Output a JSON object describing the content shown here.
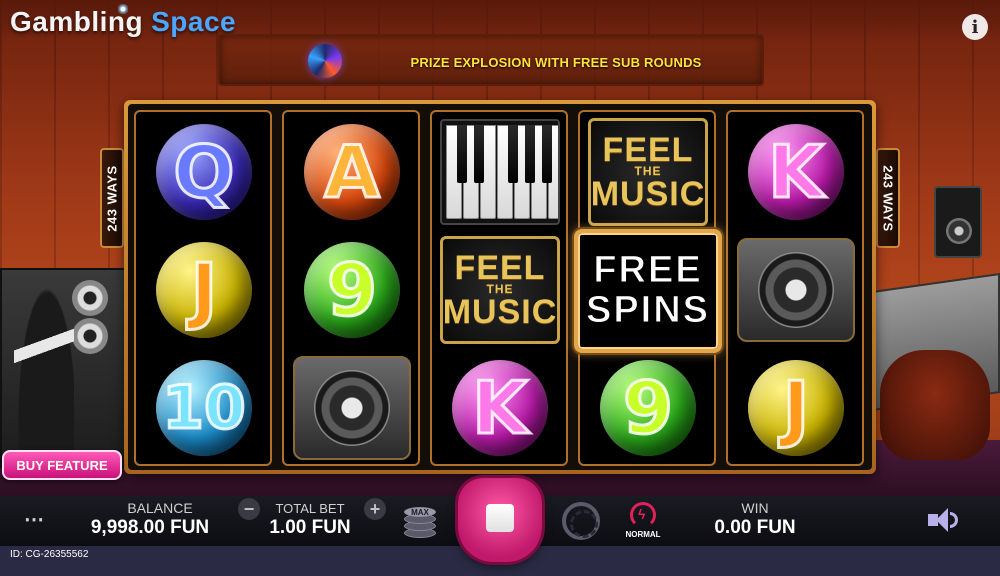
{
  "app": {
    "logo_word1": "Gambling",
    "logo_word2": "Space",
    "info_label": "i"
  },
  "banner": {
    "text": "PRIZE EXPLOSION WITH FREE SUB ROUNDS"
  },
  "ways": {
    "left": "243 WAYS",
    "right": "243 WAYS"
  },
  "reels": [
    [
      {
        "symbol": "Q",
        "style": "orb-blue"
      },
      {
        "symbol": "J",
        "style": "orb-yellow"
      },
      {
        "symbol": "10",
        "style": "orb-cyan"
      }
    ],
    [
      {
        "symbol": "A",
        "style": "orb-orange"
      },
      {
        "symbol": "9",
        "style": "orb-green"
      },
      {
        "symbol": "speaker",
        "style": "speaker"
      }
    ],
    [
      {
        "symbol": "piano",
        "style": "piano"
      },
      {
        "symbol": "feel-the-music",
        "style": "feel"
      },
      {
        "symbol": "K",
        "style": "orb-magenta"
      }
    ],
    [
      {
        "symbol": "feel-the-music",
        "style": "feel"
      },
      {
        "symbol": "free-spins",
        "style": "freespins"
      },
      {
        "symbol": "9",
        "style": "orb-green"
      }
    ],
    [
      {
        "symbol": "K",
        "style": "orb-magenta"
      },
      {
        "symbol": "speaker",
        "style": "speaker"
      },
      {
        "symbol": "J",
        "style": "orb-yellow"
      }
    ]
  ],
  "symbols_text": {
    "Q": "Q",
    "J": "J",
    "10": "10",
    "A": "A",
    "9": "9",
    "K": "K",
    "feel_line1": "FEEL",
    "feel_line2": "THE",
    "feel_line3": "MUSIC",
    "free_line1": "FREE",
    "free_line2": "SPINS"
  },
  "buy_feature": {
    "label": "BUY FEATURE"
  },
  "controls": {
    "menu_icon": "⋯",
    "balance_label": "BALANCE",
    "balance_value": "9,998.00 FUN",
    "total_bet_label": "TOTAL BET",
    "total_bet_value": "1.00 FUN",
    "minus_label": "−",
    "plus_label": "+",
    "max_label": "MAX",
    "speed_label": "NORMAL",
    "win_label": "WIN",
    "win_value": "0.00 FUN"
  },
  "footer": {
    "game_id": "ID: CG-26355562"
  },
  "colors": {
    "accent_pink": "#e0207a",
    "banner_text": "#ffe23a",
    "brand_blue": "#4aa6ff"
  }
}
